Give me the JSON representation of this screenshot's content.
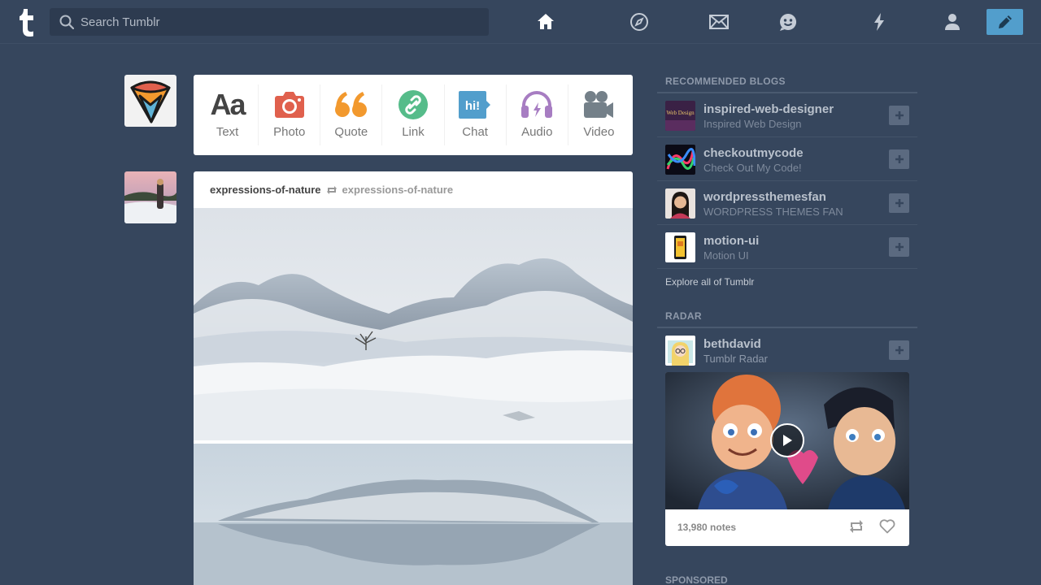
{
  "search": {
    "placeholder": "Search Tumblr"
  },
  "nav": {
    "icons": [
      "home-icon",
      "explore-compass-icon",
      "inbox-mail-icon",
      "messaging-smiley-icon",
      "activity-lightning-icon",
      "account-person-icon",
      "compose-pencil-icon"
    ],
    "compose_color": "#529ecc"
  },
  "compose": {
    "items": [
      {
        "label": "Text",
        "icon": "text-aa-icon",
        "color": "#444444"
      },
      {
        "label": "Photo",
        "icon": "camera-icon",
        "color": "#e0604d"
      },
      {
        "label": "Quote",
        "icon": "quote-icon",
        "color": "#f2992e"
      },
      {
        "label": "Link",
        "icon": "link-icon",
        "color": "#56bc8a"
      },
      {
        "label": "Chat",
        "icon": "chat-bubble-icon",
        "color": "#529ecc"
      },
      {
        "label": "Audio",
        "icon": "headphones-icon",
        "color": "#a77dc2"
      },
      {
        "label": "Video",
        "icon": "video-camera-icon",
        "color": "#748089"
      }
    ]
  },
  "post": {
    "blog_name": "expressions-of-nature",
    "reblogged_from": "expressions-of-nature"
  },
  "sidebar": {
    "recommended_heading": "RECOMMENDED BLOGS",
    "blogs": [
      {
        "name": "inspired-web-designer",
        "title": "Inspired Web Design",
        "avatar_text": "Web Design"
      },
      {
        "name": "checkoutmycode",
        "title": "Check Out My Code!"
      },
      {
        "name": "wordpressthemesfan",
        "title": "WORDPRESS THEMES FAN"
      },
      {
        "name": "motion-ui",
        "title": "Motion UI"
      }
    ],
    "explore": "Explore all of Tumblr",
    "radar_heading": "RADAR",
    "radar": {
      "name": "bethdavid",
      "title": "Tumblr Radar",
      "notes": "13,980 notes"
    },
    "sponsored_heading": "SPONSORED"
  }
}
